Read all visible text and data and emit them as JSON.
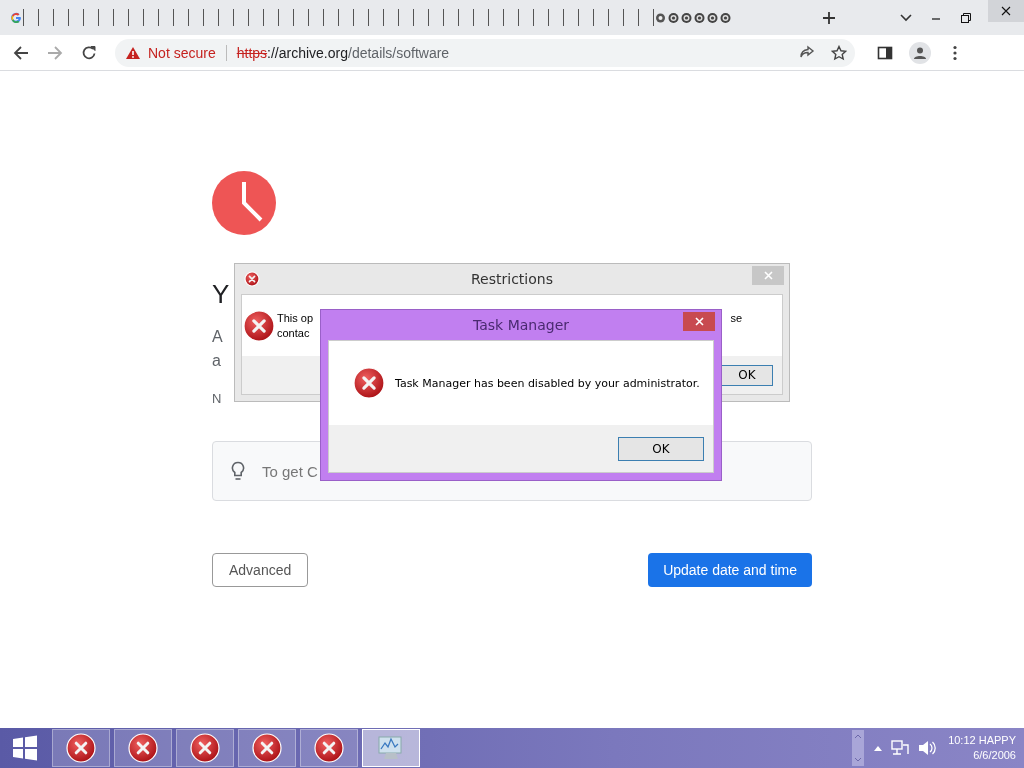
{
  "browser": {
    "tabs": [
      {
        "kind": "google"
      },
      {
        "kind": "blank"
      },
      {
        "kind": "blank"
      },
      {
        "kind": "blank"
      },
      {
        "kind": "blank"
      },
      {
        "kind": "blank"
      },
      {
        "kind": "blank"
      },
      {
        "kind": "blank"
      },
      {
        "kind": "blank"
      },
      {
        "kind": "blank"
      },
      {
        "kind": "blank"
      },
      {
        "kind": "blank"
      },
      {
        "kind": "blank"
      },
      {
        "kind": "blank"
      },
      {
        "kind": "blank"
      },
      {
        "kind": "blank"
      },
      {
        "kind": "blank"
      },
      {
        "kind": "blank"
      },
      {
        "kind": "blank"
      },
      {
        "kind": "blank"
      },
      {
        "kind": "blank"
      },
      {
        "kind": "blank"
      },
      {
        "kind": "blank"
      },
      {
        "kind": "blank"
      },
      {
        "kind": "blank"
      },
      {
        "kind": "blank"
      },
      {
        "kind": "blank"
      },
      {
        "kind": "blank"
      },
      {
        "kind": "blank"
      },
      {
        "kind": "blank"
      },
      {
        "kind": "blank"
      },
      {
        "kind": "blank"
      },
      {
        "kind": "blank"
      },
      {
        "kind": "blank"
      },
      {
        "kind": "blank"
      },
      {
        "kind": "blank"
      },
      {
        "kind": "blank"
      },
      {
        "kind": "blank"
      },
      {
        "kind": "blank"
      },
      {
        "kind": "blank"
      },
      {
        "kind": "blank"
      },
      {
        "kind": "blank"
      },
      {
        "kind": "blank"
      },
      {
        "kind": "gear"
      },
      {
        "kind": "face"
      },
      {
        "kind": "face"
      },
      {
        "kind": "face"
      },
      {
        "kind": "face"
      },
      {
        "kind": "face"
      }
    ],
    "address_bar": {
      "security_label": "Not secure",
      "url_scheme": "https",
      "url_rest": "://archive.org",
      "url_path": "/details/software"
    }
  },
  "page": {
    "heading": "Y",
    "paragraph_lines": [
      "A",
      "a"
    ],
    "note": "N",
    "tip": "To get C",
    "buttons": [
      {
        "label": "Advanced",
        "kind": "secondary"
      },
      {
        "label": "Update date and time",
        "kind": "primary"
      }
    ]
  },
  "dialogs": [
    {
      "title": "Restrictions",
      "message_parts": [
        "This op",
        "se",
        "contac"
      ],
      "button": "OK",
      "kind": "gray"
    },
    {
      "title": "Task Manager",
      "message_parts": [
        "Task Manager has been disabled by your administrator."
      ],
      "button": "OK",
      "kind": "purple"
    }
  ],
  "taskbar": {
    "items": [
      {
        "kind": "error",
        "selected": false
      },
      {
        "kind": "error",
        "selected": false
      },
      {
        "kind": "error",
        "selected": false
      },
      {
        "kind": "error",
        "selected": false
      },
      {
        "kind": "error",
        "selected": false
      },
      {
        "kind": "monitor",
        "selected": true
      }
    ],
    "clock": {
      "time": "10:12 HAPPY",
      "date": "6/6/2006"
    }
  }
}
